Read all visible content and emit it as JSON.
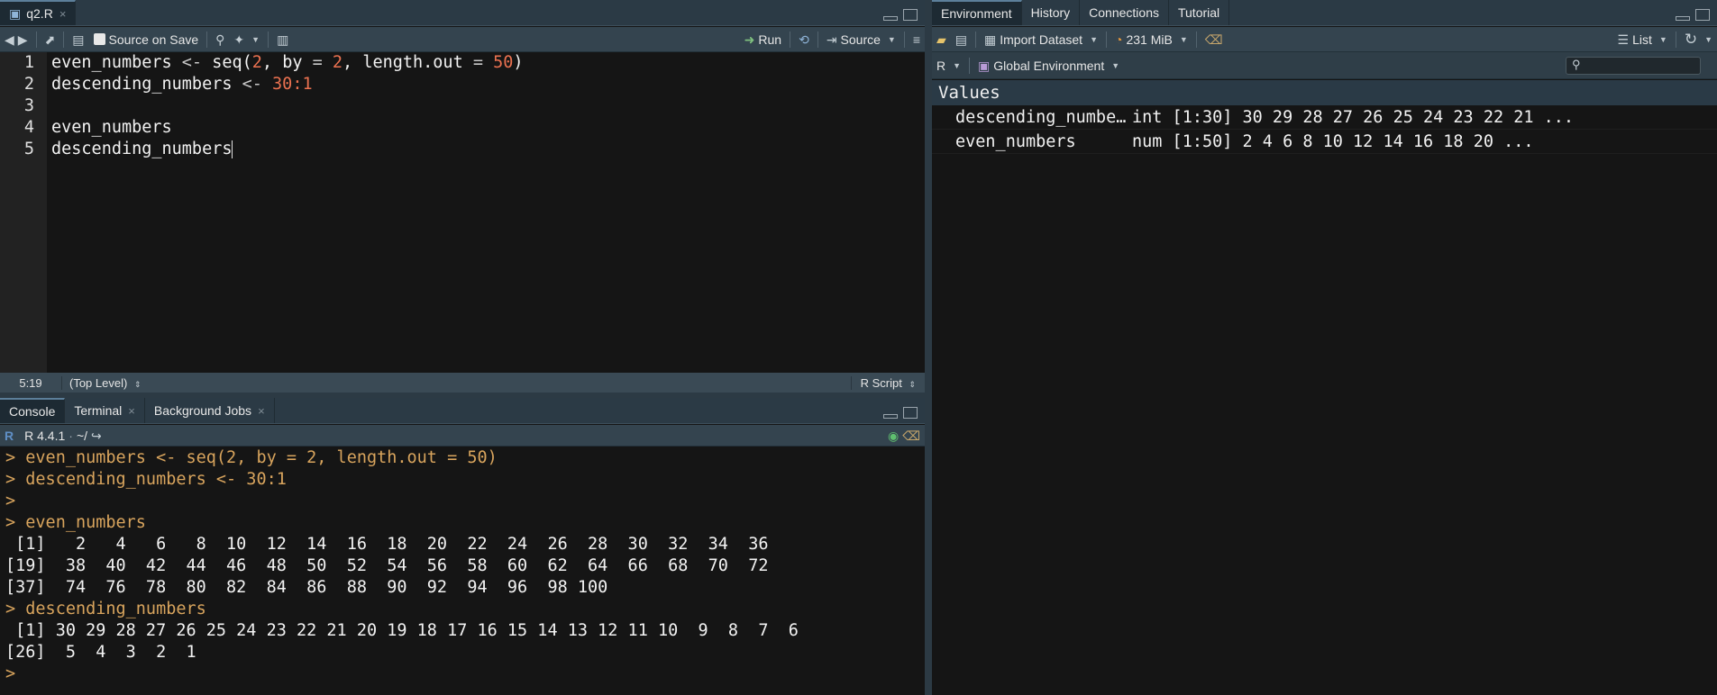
{
  "editor": {
    "tab_label": "q2.R",
    "toolbar": {
      "source_on_save": "Source on Save",
      "run": "Run",
      "source": "Source"
    },
    "line_numbers": [
      "1",
      "2",
      "3",
      "4",
      "5"
    ],
    "status": {
      "cursor": "5:19",
      "scope": "(Top Level)",
      "filetype": "R Script"
    }
  },
  "console": {
    "tabs": [
      "Console",
      "Terminal",
      "Background Jobs"
    ],
    "r_version": "R 4.4.1",
    "path": "~/",
    "lines": [
      {
        "type": "cmd",
        "text": "> even_numbers <- seq(2, by = 2, length.out = 50)"
      },
      {
        "type": "cmd",
        "text": "> descending_numbers <- 30:1"
      },
      {
        "type": "cmd",
        "text": ">"
      },
      {
        "type": "cmd",
        "text": "> even_numbers"
      },
      {
        "type": "out",
        "text": " [1]   2   4   6   8  10  12  14  16  18  20  22  24  26  28  30  32  34  36"
      },
      {
        "type": "out",
        "text": "[19]  38  40  42  44  46  48  50  52  54  56  58  60  62  64  66  68  70  72"
      },
      {
        "type": "out",
        "text": "[37]  74  76  78  80  82  84  86  88  90  92  94  96  98 100"
      },
      {
        "type": "cmd",
        "text": "> descending_numbers"
      },
      {
        "type": "out",
        "text": " [1] 30 29 28 27 26 25 24 23 22 21 20 19 18 17 16 15 14 13 12 11 10  9  8  7  6"
      },
      {
        "type": "out",
        "text": "[26]  5  4  3  2  1"
      },
      {
        "type": "cmd",
        "text": ">"
      }
    ]
  },
  "environment": {
    "tabs": [
      "Environment",
      "History",
      "Connections",
      "Tutorial"
    ],
    "toolbar": {
      "import_dataset": "Import Dataset",
      "memory": "231 MiB",
      "view": "List"
    },
    "language": "R",
    "scope": "Global Environment",
    "section": "Values",
    "rows": [
      {
        "name": "descending_numbe…",
        "value": "int [1:30] 30 29 28 27 26 25 24 23 22 21 ..."
      },
      {
        "name": "even_numbers",
        "value": "num [1:50] 2 4 6 8 10 12 14 16 18 20 ..."
      }
    ]
  }
}
